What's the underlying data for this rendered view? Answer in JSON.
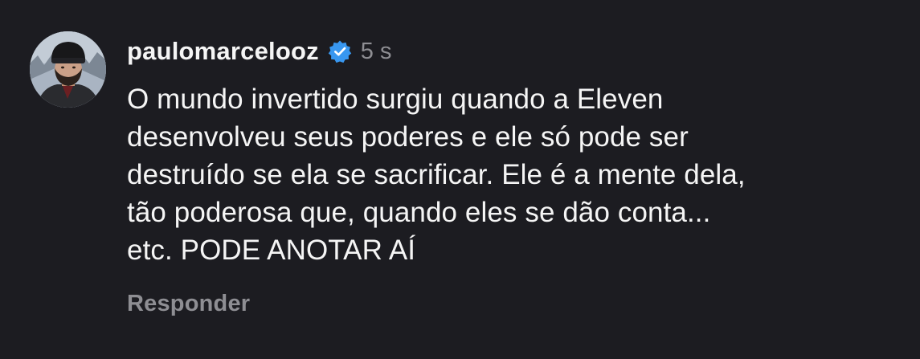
{
  "comment": {
    "username": "paulomarcelooz",
    "verified": true,
    "verified_color": "#3897f0",
    "timestamp": "5 s",
    "text": "O mundo invertido surgiu quando a Eleven\ndesenvolveu seus poderes e ele só pode ser\ndestruído se ela se sacrificar. Ele é a mente dela,\ntão poderosa que, quando eles se dão conta...\netc. PODE ANOTAR AÍ",
    "reply_label": "Responder"
  },
  "theme": {
    "background": "#1c1c21",
    "text_primary": "#f5f5f5",
    "text_secondary": "#8e8e93"
  },
  "icons": {
    "verified": "verified-badge-icon",
    "avatar": "user-avatar"
  }
}
